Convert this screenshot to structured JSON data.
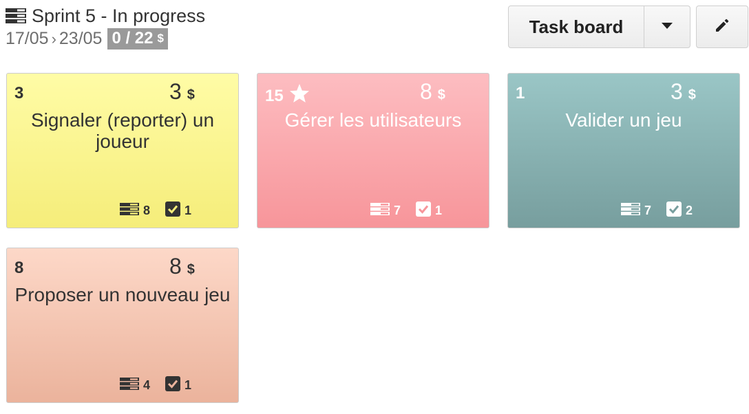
{
  "header": {
    "icon": "backlog-list-icon",
    "title": "Sprint 5 - In progress",
    "start_date": "17/05",
    "separator": "›",
    "end_date": "23/05",
    "points": "0 / 22",
    "currency": "$"
  },
  "toolbar": {
    "view_label": "Task board",
    "dropdown_icon": "caret-down-icon",
    "edit_icon": "pencil-icon"
  },
  "cards": [
    {
      "priority": "3",
      "starred": false,
      "effort": "3",
      "currency": "$",
      "title": "Signaler (reporter) un joueur",
      "tasks": "8",
      "done": "1",
      "color_top": "#fffca6",
      "color_bottom": "#f5ed7a",
      "text_color": "dark"
    },
    {
      "priority": "15",
      "starred": true,
      "effort": "8",
      "currency": "$",
      "title": "Gérer les utilisateurs",
      "tasks": "7",
      "done": "1",
      "color_top": "#fdbdc1",
      "color_bottom": "#f7959a",
      "text_color": "light"
    },
    {
      "priority": "1",
      "starred": false,
      "effort": "3",
      "currency": "$",
      "title": "Valider un jeu",
      "tasks": "7",
      "done": "2",
      "color_top": "#9ac6c6",
      "color_bottom": "#779e9e",
      "text_color": "light"
    },
    {
      "priority": "8",
      "starred": false,
      "effort": "8",
      "currency": "$",
      "title": "Proposer un nouveau jeu",
      "tasks": "4",
      "done": "1",
      "color_top": "#fdd8c8",
      "color_bottom": "#ebb39c",
      "text_color": "dark"
    }
  ]
}
